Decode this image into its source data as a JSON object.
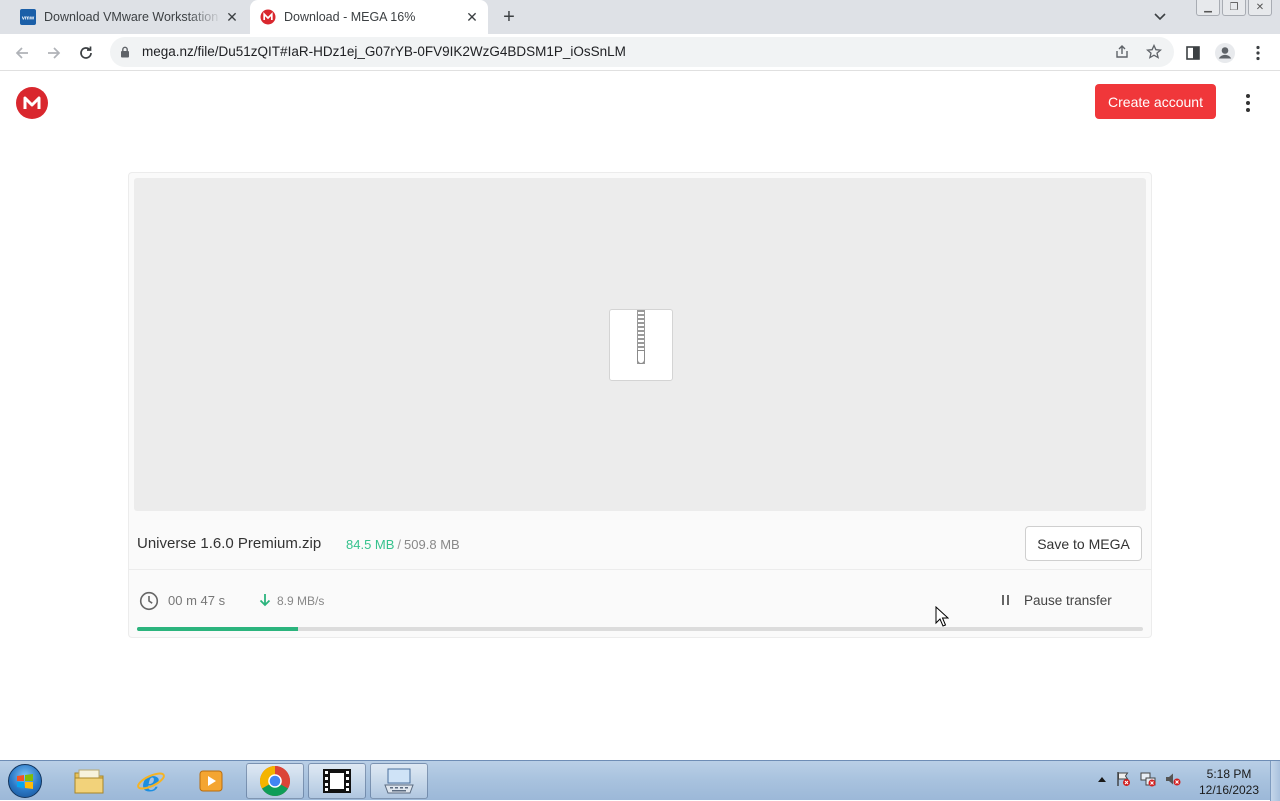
{
  "browser": {
    "tabs": [
      {
        "title": "Download VMware Workstation",
        "active": false,
        "favicon": "vmware-icon"
      },
      {
        "title": "Download - MEGA 16%",
        "active": true,
        "favicon": "mega-icon"
      }
    ],
    "new_tab_label": "+",
    "url": "mega.nz/file/Du51zQIT#IaR-HDz1ej_G07rYB-0FV9IK2WzG4BDSM1P_iOsSnLM"
  },
  "header": {
    "logo_letter": "M",
    "create_account_label": "Create account"
  },
  "download": {
    "file_name": "Universe 1.6.0 Premium.zip",
    "downloaded": "84.5 MB",
    "separator": "/",
    "total_size": "509.8 MB",
    "save_button_label": "Save to MEGA",
    "time_remaining": "00 m  47 s",
    "speed": "8.9 MB/s",
    "pause_label": "Pause transfer",
    "progress_fraction": 0.16
  },
  "taskbar": {
    "time": "5:18 PM",
    "date": "12/16/2023"
  },
  "colors": {
    "mega_red": "#d9272e",
    "create_button": "#f0373a",
    "progress_green": "#2bb47d",
    "downloaded_text": "#36c28d"
  }
}
